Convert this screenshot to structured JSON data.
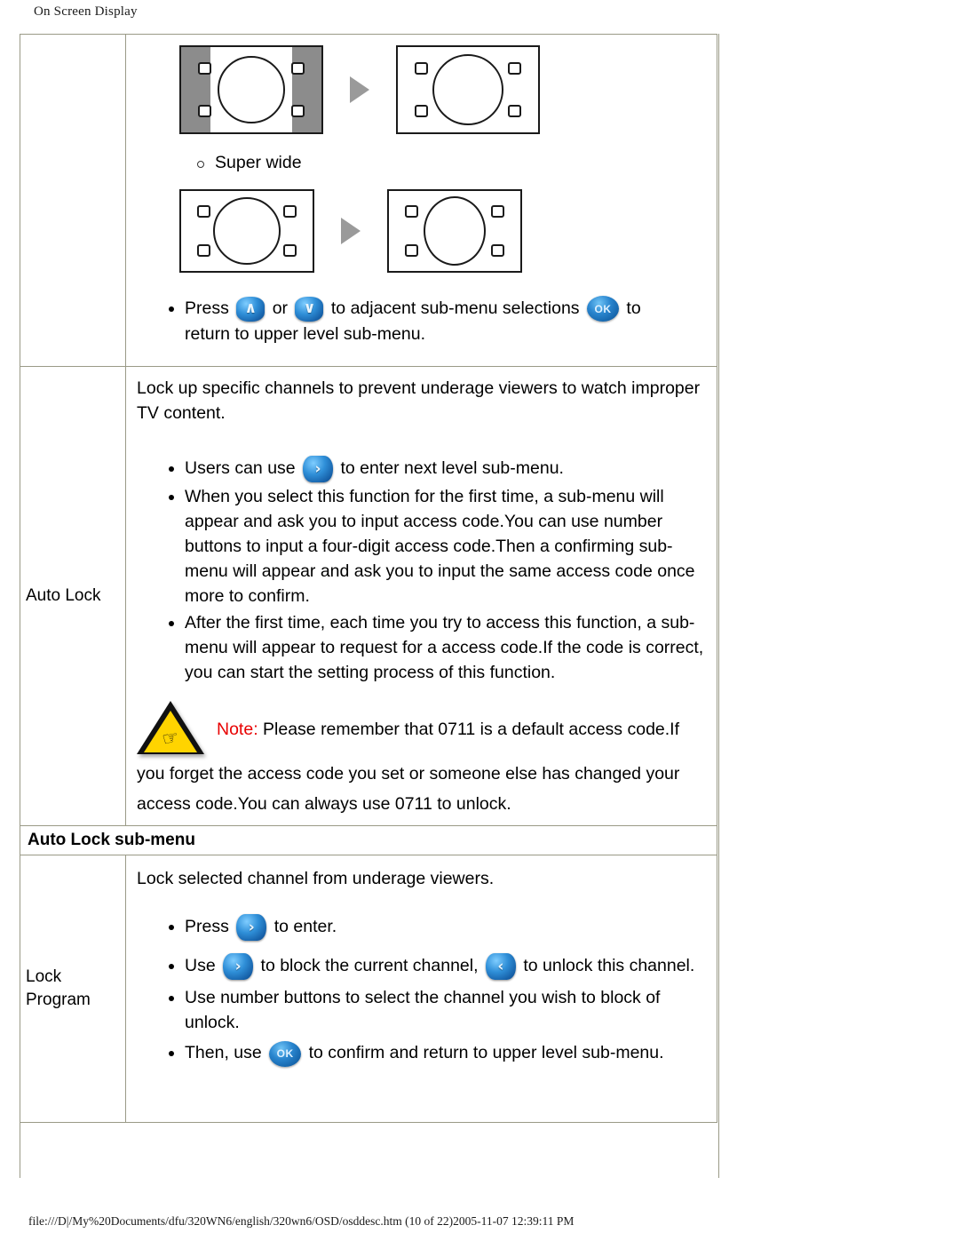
{
  "header": {
    "title": "On Screen Display"
  },
  "footer": {
    "path": "file:///D|/My%20Documents/dfu/320WN6/english/320wn6/OSD/osddesc.htm (10 of 22)2005-11-07 12:39:11 PM"
  },
  "icons": {
    "up": "∧",
    "down": "∨",
    "right": "›",
    "left": "‹",
    "ok": "OK",
    "hand": "☞"
  },
  "colors": {
    "button_blue": "#1660a8",
    "button_highlight": "#7fcdff",
    "warning_yellow": "#ffd400",
    "note_red": "#e80000",
    "table_border": "#9a9a87",
    "pillar_gray": "#8c8c8c",
    "arrow_gray": "#9a9a9a"
  },
  "rows": {
    "picture_format": {
      "label": "",
      "option_label": "Super wide",
      "press_line": {
        "pre": "Press",
        "mid_or": "or",
        "post": "to adjacent sub-menu selections",
        "tail": "to",
        "second_line": "return to upper level sub-menu."
      }
    },
    "auto_lock": {
      "label": "Auto Lock",
      "intro": "Lock up specific channels to prevent underage viewers to watch improper TV content.",
      "bullets": [
        {
          "pre": "Users can use",
          "post": "to enter next level sub-menu.",
          "icon": "right"
        },
        {
          "pre": "",
          "post": "When you select this function for the first time, a sub-menu will appear and ask you to input access code.You can use number buttons to input a four-digit access code.Then a confirming sub-menu will appear and ask you to input the same access code once more to confirm.",
          "icon": ""
        },
        {
          "pre": "",
          "post": "After the first time, each time you try to access this function, a sub-menu will appear to request for a access code.If the code is correct, you can start the setting process of this function.",
          "icon": ""
        }
      ],
      "note": {
        "keyword": "Note:",
        "line1": " Please remember that 0711 is a default access code.If",
        "line2": "you forget the access code you set or someone else has changed your",
        "line3": "access code.You can always use 0711 to unlock."
      }
    },
    "section_header": {
      "title": "Auto Lock sub-menu"
    },
    "lock_program": {
      "label_line1": "Lock",
      "label_line2": "Program",
      "intro": "Lock selected channel from underage viewers.",
      "bullets": [
        {
          "pre": "Press",
          "post": "to enter.",
          "icon": "right"
        },
        {
          "pre": "Use",
          "mid": "to block the current channel,",
          "post": "to unlock this channel.",
          "icon": "right",
          "icon2": "left"
        },
        {
          "pre": "",
          "post": "Use number buttons to select the channel you wish to block of unlock.",
          "icon": ""
        },
        {
          "pre": "Then, use",
          "post": "to confirm and return to upper level sub-menu.",
          "icon": "ok"
        }
      ]
    }
  }
}
